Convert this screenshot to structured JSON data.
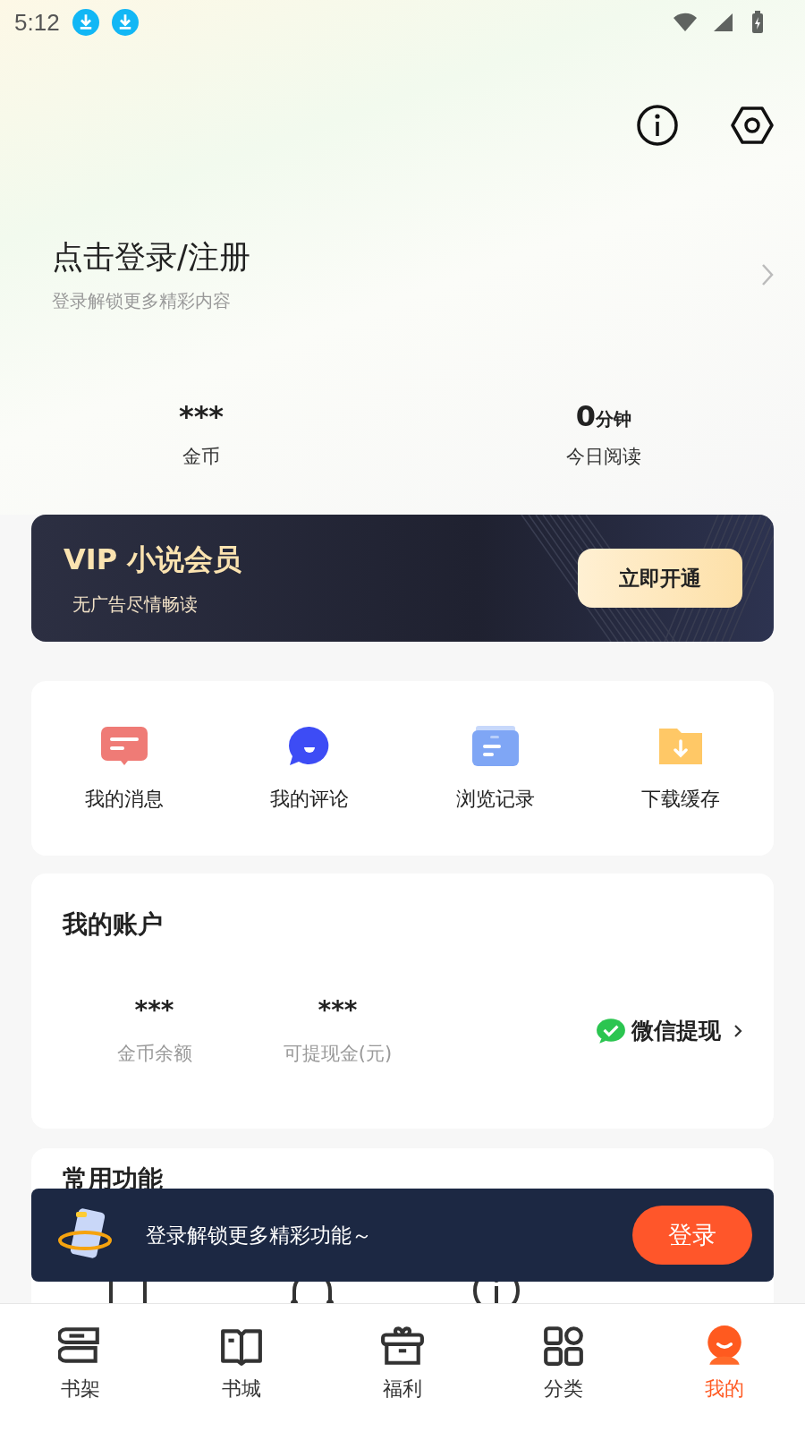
{
  "status_bar": {
    "time": "5:12"
  },
  "login": {
    "title": "点击登录/注册",
    "subtitle": "登录解锁更多精彩内容"
  },
  "stats": [
    {
      "value": "***",
      "label": "金币"
    },
    {
      "value": "0",
      "unit": "分钟",
      "label": "今日阅读"
    }
  ],
  "vip_banner": {
    "title": "VIP 小说会员",
    "subtitle": "无广告尽情畅读",
    "button": "立即开通"
  },
  "shortcuts": [
    {
      "kind": "message",
      "label": "我的消息"
    },
    {
      "kind": "comment",
      "label": "我的评论"
    },
    {
      "kind": "history",
      "label": "浏览记录"
    },
    {
      "kind": "download",
      "label": "下载缓存"
    }
  ],
  "account": {
    "title": "我的账户",
    "items": [
      {
        "value": "***",
        "label": "金币余额"
      },
      {
        "value": "***",
        "label": "可提现金(元)"
      }
    ],
    "wechat": "微信提现"
  },
  "common": {
    "title": "常用功能"
  },
  "login_prompt": {
    "text": "登录解锁更多精彩功能～",
    "button": "登录"
  },
  "tabs": [
    {
      "kind": "shelf",
      "label": "书架",
      "selected": false
    },
    {
      "kind": "store",
      "label": "书城",
      "selected": false
    },
    {
      "kind": "gift",
      "label": "福利",
      "selected": false
    },
    {
      "kind": "grid",
      "label": "分类",
      "selected": false
    },
    {
      "kind": "me",
      "label": "我的",
      "selected": true
    }
  ]
}
